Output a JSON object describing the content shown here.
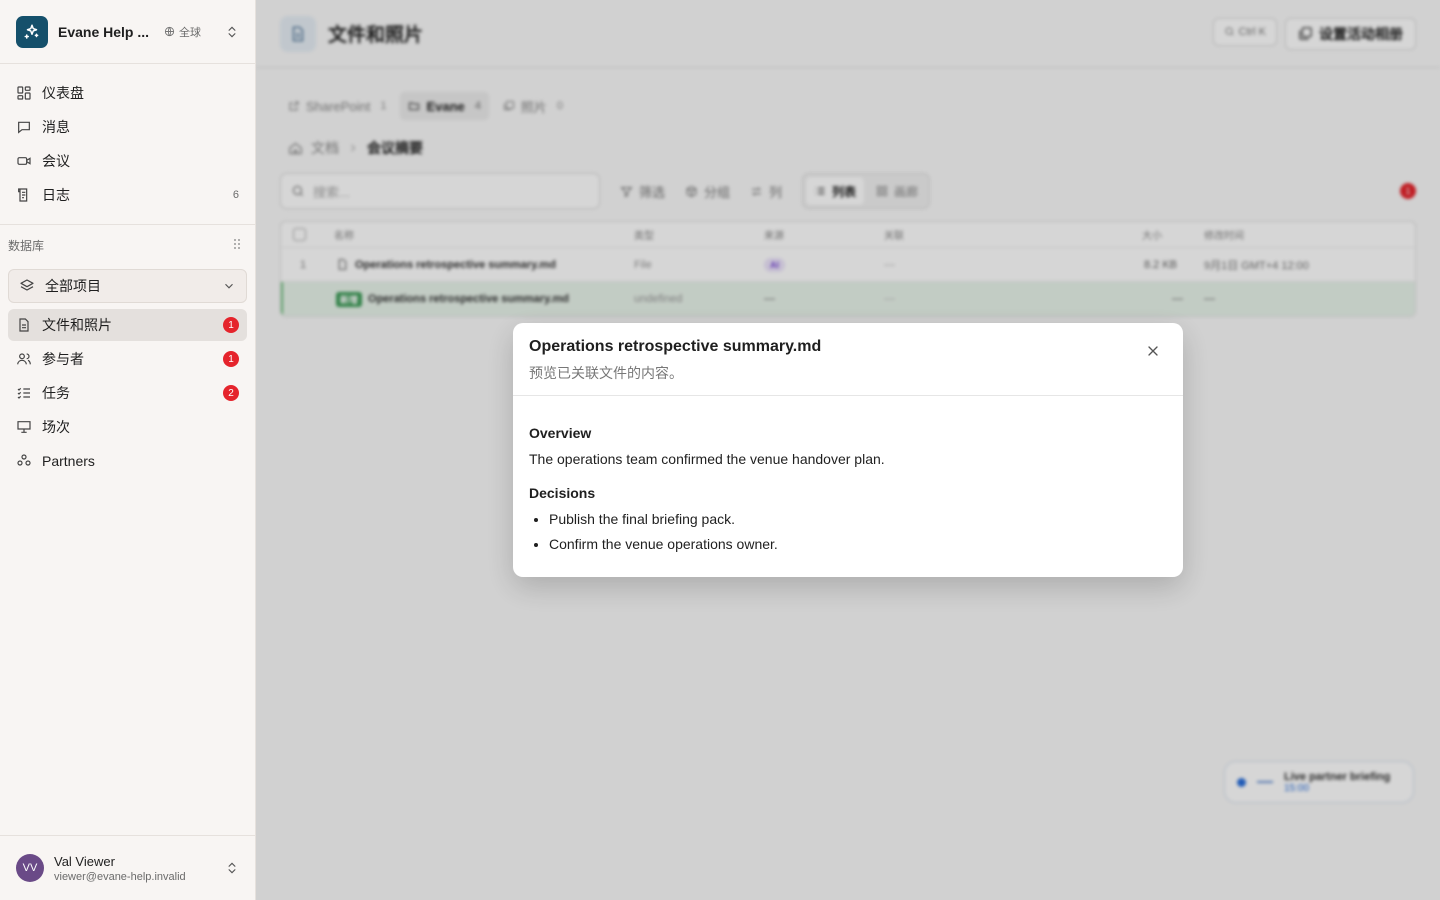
{
  "workspace": {
    "name": "Evane Help ...",
    "scope": "全球"
  },
  "nav": [
    {
      "label": "仪表盘",
      "count": ""
    },
    {
      "label": "消息",
      "count": ""
    },
    {
      "label": "会议",
      "count": ""
    },
    {
      "label": "日志",
      "count": "6"
    }
  ],
  "database": {
    "section_label": "数据库",
    "selected": "全部项目",
    "items": [
      {
        "label": "文件和照片",
        "badge": "1"
      },
      {
        "label": "参与者",
        "badge": "1"
      },
      {
        "label": "任务",
        "badge": "2"
      },
      {
        "label": "场次",
        "badge": ""
      },
      {
        "label": "Partners",
        "badge": ""
      }
    ]
  },
  "user": {
    "initials": "VV",
    "name": "Val Viewer",
    "email": "viewer@evane-help.invalid"
  },
  "header": {
    "title": "文件和照片",
    "shortcut": "Ctrl K",
    "action": "设置活动相册"
  },
  "tabs": [
    {
      "label": "SharePoint",
      "count": "1"
    },
    {
      "label": "Evane",
      "count": "4"
    },
    {
      "label": "照片",
      "count": "0"
    }
  ],
  "breadcrumb": {
    "root": "文档",
    "current": "会议摘要"
  },
  "toolbar": {
    "search_placeholder": "搜索...",
    "filter": "筛选",
    "group": "分组",
    "columns": "列",
    "view_list": "列表",
    "view_gallery": "画廊",
    "alert_count": "1"
  },
  "table": {
    "headers": [
      "名称",
      "类型",
      "来源",
      "关联",
      "大小",
      "修改时间"
    ],
    "rows": [
      {
        "index": "1",
        "name": "Operations retrospective summary.md",
        "type": "File",
        "source": "AI",
        "link": "—",
        "size": "8.2 KB",
        "modified": "9月1日 GMT+4 12:00"
      },
      {
        "tag": "新增",
        "name": "Operations retrospective summary.md",
        "type": "undefined",
        "source": "—",
        "link": "—",
        "size": "—",
        "modified": "—"
      }
    ]
  },
  "floating": {
    "title": "Live partner briefing",
    "time": "15:00"
  },
  "dialog": {
    "title": "Operations retrospective summary.md",
    "subtitle": "预览已关联文件的内容。",
    "overview_heading": "Overview",
    "overview_text": "The operations team confirmed the venue handover plan.",
    "decisions_heading": "Decisions",
    "decisions": [
      "Publish the final briefing pack.",
      "Confirm the venue operations owner."
    ]
  }
}
